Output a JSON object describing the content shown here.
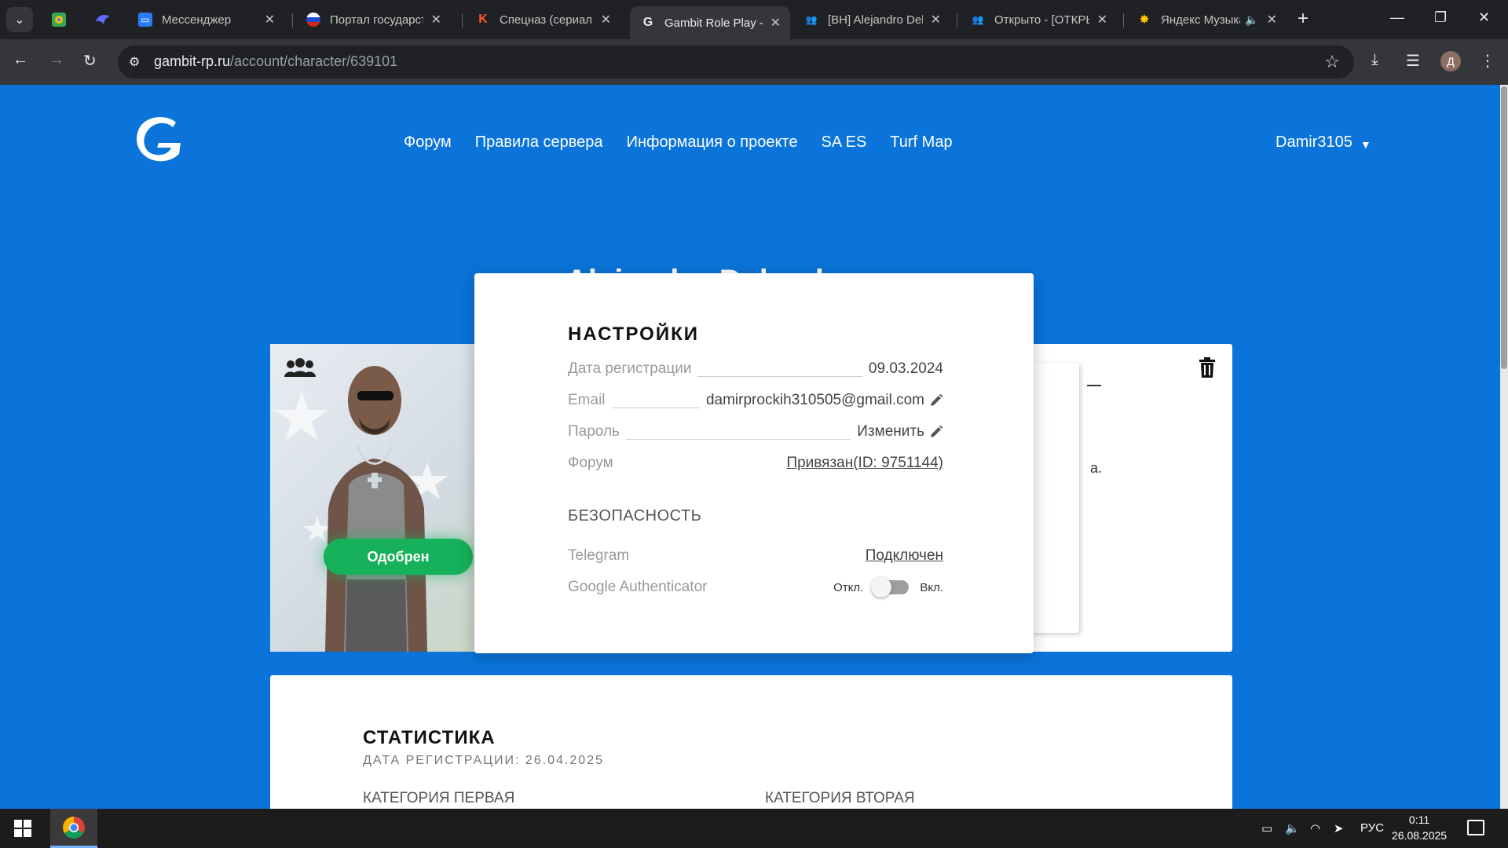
{
  "browser": {
    "tabs": [
      {
        "title": "",
        "favicon": "maps-icon",
        "pinned": true
      },
      {
        "title": "",
        "favicon": "bird-icon",
        "pinned": true
      },
      {
        "title": "Мессенджер",
        "favicon": "chat-icon",
        "pinned": false
      },
      {
        "title": "Портал государственных",
        "favicon": "flag-ru-icon",
        "pinned": false
      },
      {
        "title": "Спецназ (сериал,",
        "favicon": "k-logo-icon",
        "pinned": false
      },
      {
        "title": "Gambit Role Play -",
        "favicon": "gambit-logo-icon",
        "pinned": false,
        "active": true
      },
      {
        "title": "[BH] Alejandro Del",
        "favicon": "group-icon",
        "pinned": false
      },
      {
        "title": "Открыто - [ОТКРЫТО]",
        "favicon": "group-icon",
        "pinned": false
      },
      {
        "title": "Яндекс Музыка",
        "favicon": "yandex-music-icon",
        "pinned": false,
        "audio": true
      }
    ],
    "url_host": "gambit-rp.ru",
    "url_path": "/account/character/639101",
    "profile_initial": "Д"
  },
  "site": {
    "nav": [
      "Форум",
      "Правила сервера",
      "Информация о проекте",
      "SA ES",
      "Turf Map"
    ],
    "username": "Damir3105",
    "character_title": "Alejandro Delgado",
    "status_badge": "Одобрен",
    "behind_text": "а."
  },
  "settings_modal": {
    "title": "НАСТРОЙКИ",
    "rows": {
      "reg_date": {
        "label": "Дата регистрации",
        "value": "09.03.2024"
      },
      "email": {
        "label": "Email",
        "value": "damirprockih310505@gmail.com"
      },
      "password": {
        "label": "Пароль",
        "value": "Изменить"
      },
      "forum": {
        "label": "Форум",
        "value": "Привязан(ID: 9751144)"
      }
    },
    "security": {
      "title": "БЕЗОПАСНОСТЬ",
      "telegram": {
        "label": "Telegram",
        "value": "Подключен"
      },
      "google_auth": {
        "label": "Google Authenticator",
        "off_label": "Откл.",
        "on_label": "Вкл.",
        "enabled": false
      }
    }
  },
  "stats": {
    "title": "СТАТИСТИКА",
    "subtitle": "ДАТА РЕГИСТРАЦИИ: 26.04.2025",
    "category_one": "КАТЕГОРИЯ ПЕРВАЯ",
    "category_two": "КАТЕГОРИЯ ВТОРАЯ"
  },
  "taskbar": {
    "language": "РУС",
    "time": "0:11",
    "date": "26.08.2025"
  },
  "colors": {
    "page_bg": "#0a74da",
    "approved_green": "#16b15a"
  }
}
